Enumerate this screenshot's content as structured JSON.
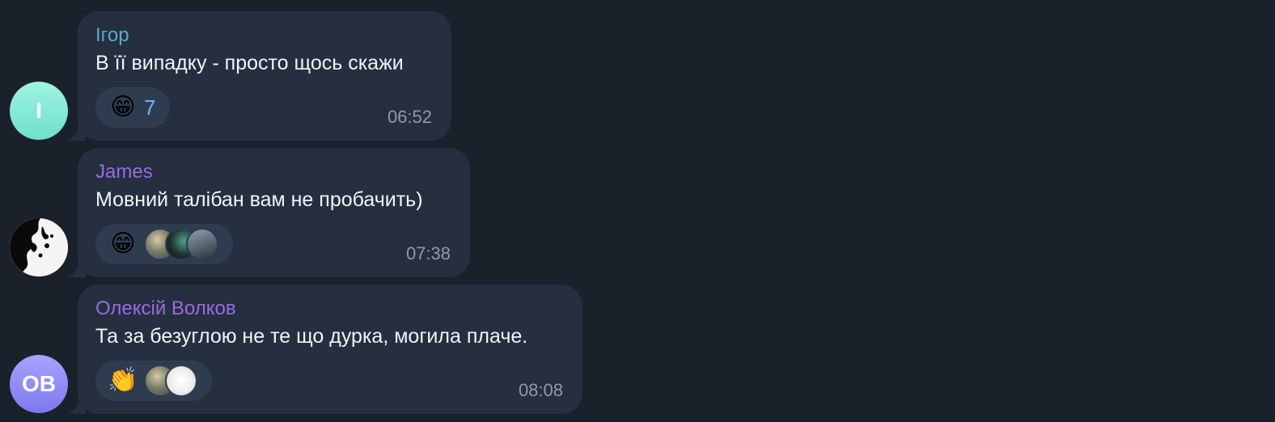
{
  "colors": {
    "background": "#1a212b",
    "bubble": "#252f3f",
    "reaction_chip": "#2f3c50",
    "message_text": "#f2f4f7",
    "time_text": "#8e9aab",
    "reaction_count": "#6fb0ff"
  },
  "messages": [
    {
      "avatar_initials": "I",
      "avatar_color": "#8eeedb",
      "sender": "Ігор",
      "sender_color": "#5fa7c9",
      "text": "В її випадку - просто щось скажи",
      "reaction_emoji": "😁",
      "reaction_emoji_icon": "grinning-face-icon",
      "reaction_count": "7",
      "time": "06:52"
    },
    {
      "avatar_initials": "",
      "avatar_style": "black-white-abstract",
      "sender": "James",
      "sender_color": "#9a6be0",
      "text": "Мовний талібан вам не пробачить)",
      "reaction_emoji": "😁",
      "reaction_emoji_icon": "grinning-face-icon",
      "reactor_avatars": 3,
      "time": "07:38"
    },
    {
      "avatar_initials": "OB",
      "avatar_color": "#938ef8",
      "sender": "Олексій Волков",
      "sender_color": "#9a6be0",
      "text": "Та за безуглою не те що дурка, могила плаче.",
      "reaction_emoji": "👏",
      "reaction_emoji_icon": "clapping-hands-icon",
      "reactor_avatars": 2,
      "time": "08:08"
    }
  ]
}
